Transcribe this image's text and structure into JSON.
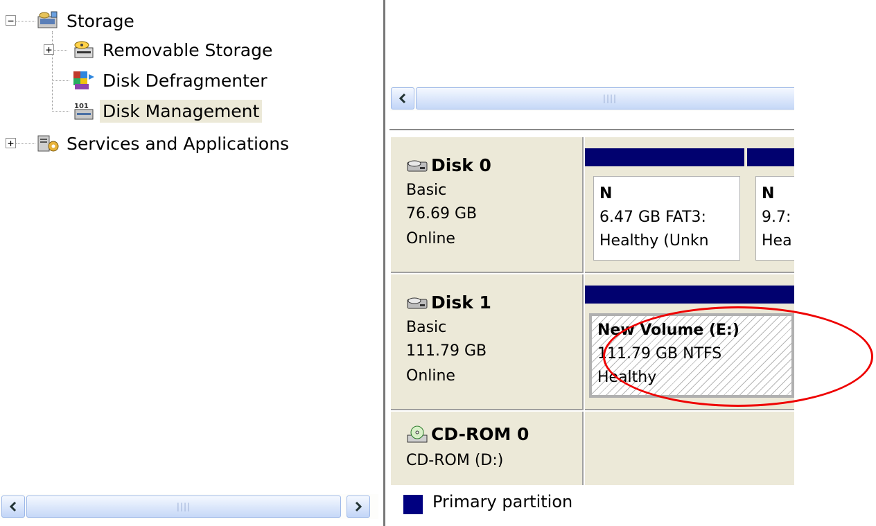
{
  "tree": {
    "items": [
      {
        "label": "Storage",
        "icon": "storage-icon",
        "expander": "−"
      },
      {
        "label": "Removable Storage",
        "icon": "removable-storage-icon",
        "expander": "+"
      },
      {
        "label": "Disk Defragmenter",
        "icon": "disk-defragmenter-icon"
      },
      {
        "label": "Disk Management",
        "icon": "disk-management-icon",
        "selected": true
      },
      {
        "label": "Services and Applications",
        "icon": "services-applications-icon",
        "expander": "+"
      }
    ]
  },
  "disks": [
    {
      "name": "Disk 0",
      "type": "Basic",
      "size": "76.69 GB",
      "status": "Online",
      "partitions": [
        {
          "line1": "N",
          "line2": "6.47 GB FAT3:",
          "line3": "Healthy (Unkn"
        },
        {
          "line1": "N",
          "line2": "9.7:",
          "line3": "Hea"
        }
      ]
    },
    {
      "name": "Disk 1",
      "type": "Basic",
      "size": "111.79 GB",
      "status": "Online",
      "partitions": [
        {
          "line1": "New Volume  (E:)",
          "line2": "111.79 GB NTFS",
          "line3": "Healthy"
        }
      ]
    },
    {
      "name": "CD-ROM 0",
      "type": "CD-ROM (D:)"
    }
  ],
  "legend": {
    "label": "Primary partition",
    "color": "#000080"
  },
  "colors": {
    "partition_bar": "#01016f",
    "panel": "#ece9d8",
    "highlight_circle": "#e00000"
  }
}
